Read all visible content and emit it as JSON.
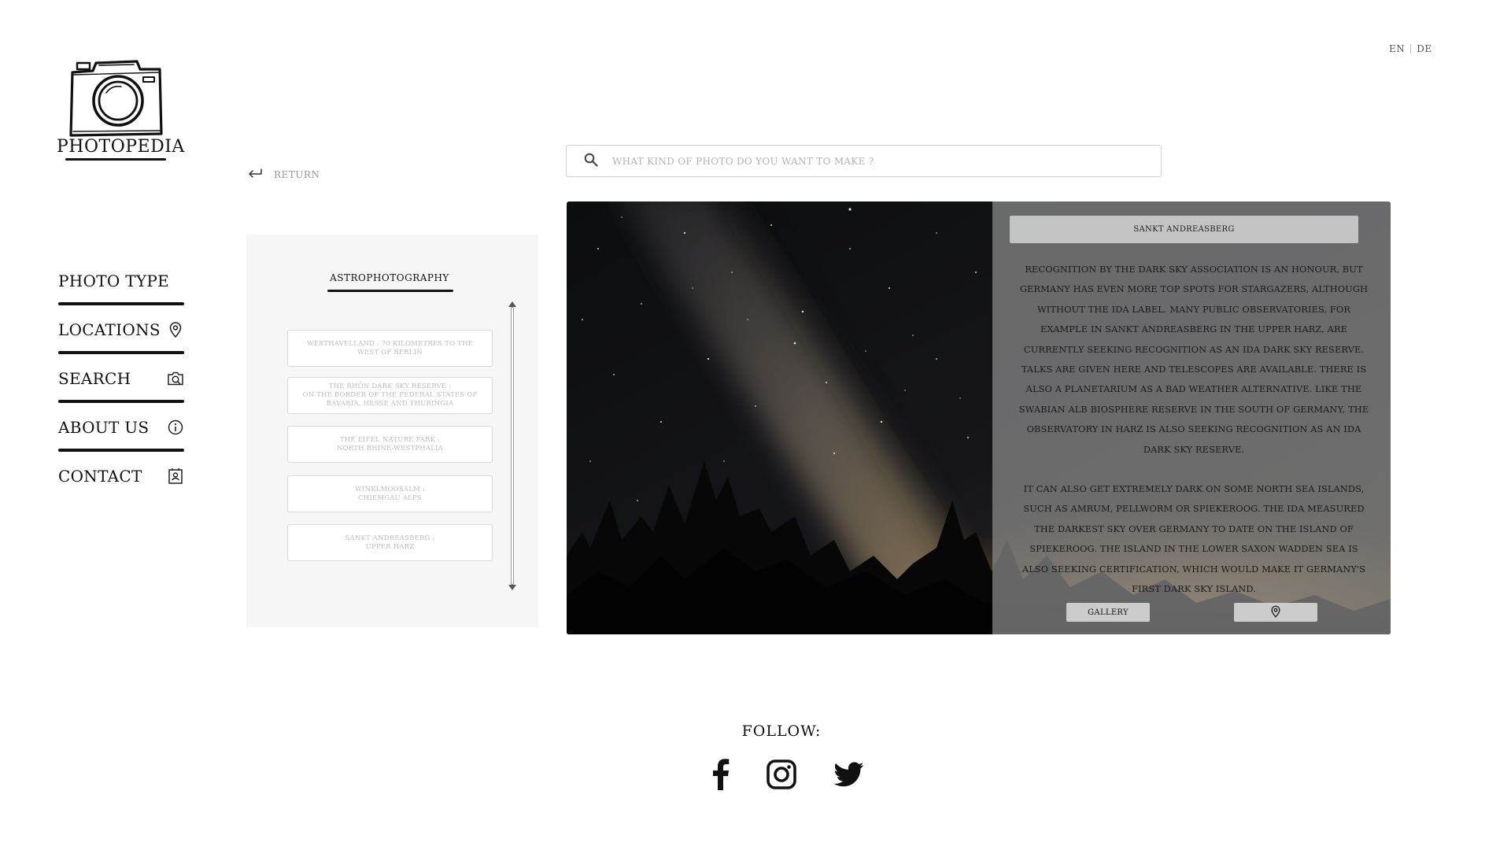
{
  "language": {
    "options": [
      "EN",
      "DE"
    ],
    "active": "EN"
  },
  "brand": {
    "name": "PHOTOPEDIA",
    "icon": "camera-icon"
  },
  "nav": {
    "items": [
      {
        "label": "PHOTO TYPE",
        "icon": ""
      },
      {
        "label": "LOCATIONS",
        "icon": "map-pin-icon"
      },
      {
        "label": "SEARCH",
        "icon": "camera-search-icon"
      },
      {
        "label": "ABOUT US",
        "icon": "info-icon"
      },
      {
        "label": "CONTACT",
        "icon": "contact-card-icon"
      }
    ]
  },
  "return_link": {
    "label": "RETURN",
    "icon": "return-arrow-icon"
  },
  "search": {
    "placeholder": "WHAT KIND OF PHOTO DO YOU WANT TO MAKE ?",
    "value": "",
    "icon": "search-icon"
  },
  "panel": {
    "title": "ASTROPHOTOGRAPHY",
    "locations": [
      "WESTHAVELLAND : 70 KILOMETRES TO THE\nWEST OF BERLIN",
      "THE RHÖN DARK SKY RESERVE :\nON THE BORDER OF THE FEDERAL STATES OF\nBAVARIA, HESSE AND THURINGIA",
      "THE EIFEL NATURE PARK :\nNORTH RHINE-WESTPHALIA",
      "WINKLMOOSALM :\nCHIEMGAU ALPS",
      "SANKT ANDREASBERG :\nUPPER HARZ"
    ]
  },
  "detail": {
    "title": "SANKT ANDREASBERG",
    "paragraphs": [
      "Recognition by the Dark Sky Association is an honour, but Germany has even more top spots for stargazers, although without the IDA label. Many public observatories, for example in Sankt Andreasberg in the Upper Harz, are currently seeking recognition as an IDA Dark Sky Reserve. Talks are given here and telescopes are available. There is also a planetarium as a bad weather alternative. Like the Swabian Alb Biosphere Reserve in the south of Germany, the observatory in Harz is also seeking recognition as an IDA Dark Sky Reserve.",
      "It can also get extremely dark on some North Sea islands, such as Amrum, Pellworm or Spiekeroog. The IDA measured the darkest sky over Germany to date on the island of Spiekeroog. The island in the Lower Saxon Wadden Sea is also seeking certification, which would make it Germany's first dark sky island."
    ],
    "gallery_label": "GALLERY",
    "map_button_icon": "map-pin-icon"
  },
  "footer": {
    "follow_label": "FOLLOW:",
    "social": [
      "facebook-icon",
      "instagram-icon",
      "twitter-icon"
    ]
  }
}
